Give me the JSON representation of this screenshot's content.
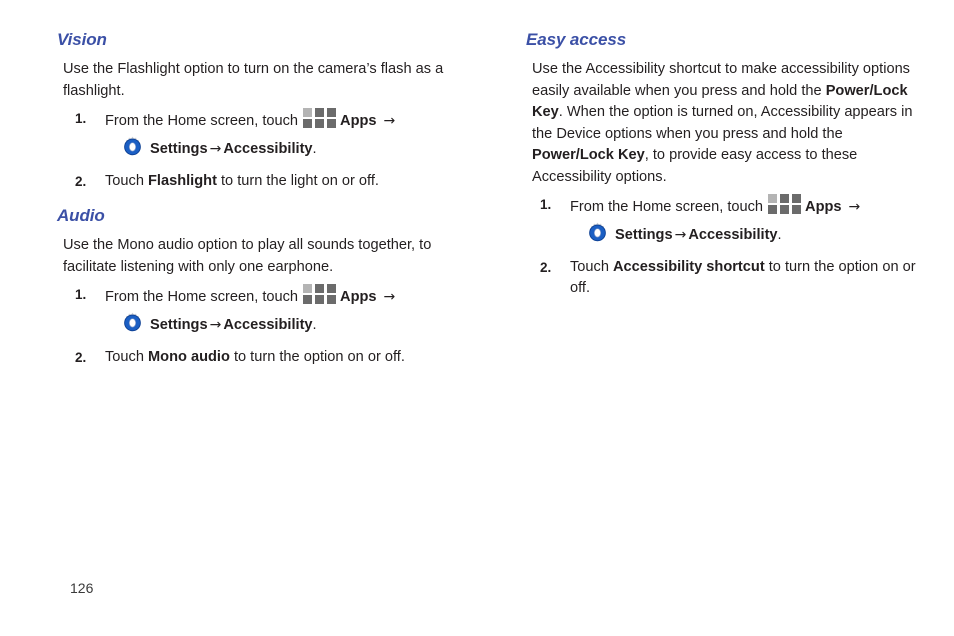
{
  "page": {
    "number": "126",
    "heading_color": "#3b50a6",
    "body_color": "#231f20",
    "icons": {
      "apps": "apps-grid-icon",
      "settings": "settings-gear-icon",
      "arrow": "→"
    }
  },
  "left_column": {
    "sections": [
      {
        "heading": "Vision",
        "paragraph": "Use the Flashlight option to turn on the camera’s flash as a flashlight.",
        "steps": [
          {
            "number": "1.",
            "line1_prefix": "From the Home screen, touch",
            "apps_label": "Apps",
            "arrow1": "→",
            "settings_label": "Settings",
            "arrow2": "→",
            "accessibility_label": "Accessibility",
            "period": "."
          },
          {
            "number": "2.",
            "text_prefix": "Touch",
            "bold_term": "Flashlight",
            "text_suffix": "to turn the light on or off."
          }
        ]
      },
      {
        "heading": "Audio",
        "paragraph": "Use the Mono audio option to play all sounds together, to facilitate listening with only one earphone.",
        "steps": [
          {
            "number": "1.",
            "line1_prefix": "From the Home screen, touch",
            "apps_label": "Apps",
            "arrow1": "→",
            "settings_label": "Settings",
            "arrow2": "→",
            "accessibility_label": "Accessibility",
            "period": "."
          },
          {
            "number": "2.",
            "text_prefix": "Touch",
            "bold_term": "Mono audio",
            "text_suffix": "to turn the option on or off."
          }
        ]
      }
    ]
  },
  "right_column": {
    "sections": [
      {
        "heading": "Easy access",
        "paragraph_part1": "Use the Accessibility shortcut to make accessibility options easily available when you press and hold the ",
        "paragraph_bold1": "Power/Lock Key",
        "paragraph_part2": ". When the option is turned on, Accessibility appears in the Device options when you press and hold the ",
        "paragraph_bold2": "Power/Lock Key",
        "paragraph_part3": ", to provide easy access to these Accessibility options.",
        "steps": [
          {
            "number": "1.",
            "line1_prefix": "From the Home screen, touch",
            "apps_label": "Apps",
            "arrow1": "→",
            "settings_label": "Settings",
            "arrow2": "→",
            "accessibility_label": "Accessibility",
            "period": "."
          },
          {
            "number": "2.",
            "text_prefix": "Touch",
            "bold_term": "Accessibility shortcut",
            "text_suffix": "to turn the option on or off."
          }
        ]
      }
    ]
  }
}
